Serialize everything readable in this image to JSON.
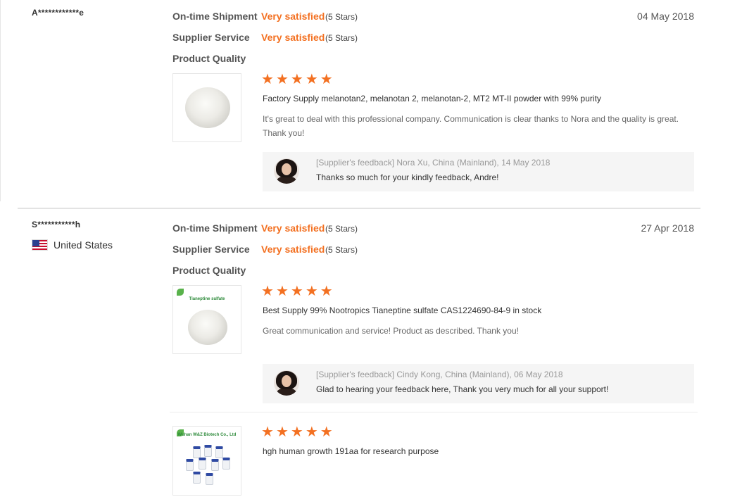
{
  "reviews": [
    {
      "buyer": "A************e",
      "country": "",
      "date": "04 May 2018",
      "ratings": [
        {
          "label": "On-time Shipment",
          "value": "Very satisfied",
          "stars": "(5 Stars)"
        },
        {
          "label": "Supplier Service",
          "value": "Very satisfied",
          "stars": "(5 Stars)"
        },
        {
          "label": "Product Quality",
          "value": "",
          "stars": ""
        }
      ],
      "products": [
        {
          "image_icon": "white-powder-image",
          "image_caption": "",
          "star_count": 5,
          "title": "Factory Supply melanotan2, melanotan 2, melanotan-2, MT2 MT-II powder with 99% purity",
          "comment_line1": "It's great to deal with this professional company. Communication is clear thanks to Nora and the quality is great.",
          "comment_line2": "Thank you!",
          "feedback": {
            "meta": "[Supplier's feedback] Nora Xu, China (Mainland), 14 May 2018",
            "text": "Thanks so much for your kindly feedback, Andre!"
          }
        }
      ]
    },
    {
      "buyer": "S***********h",
      "country": "United States",
      "country_flag_icon": "us-flag-icon",
      "date": "27 Apr 2018",
      "ratings": [
        {
          "label": "On-time Shipment",
          "value": "Very satisfied",
          "stars": "(5 Stars)"
        },
        {
          "label": "Supplier Service",
          "value": "Very satisfied",
          "stars": "(5 Stars)"
        },
        {
          "label": "Product Quality",
          "value": "",
          "stars": ""
        }
      ],
      "products": [
        {
          "image_icon": "tianeptine-powder-image",
          "image_caption": "Tianeptine sulfate",
          "star_count": 5,
          "title": "Best Supply 99% Nootropics Tianeptine sulfate CAS1224690-84-9 in stock",
          "comment_line1": "Great communication and service! Product as described. Thank you!",
          "feedback": {
            "meta": "[Supplier's feedback] Cindy Kong, China (Mainland), 06 May 2018",
            "text": "Glad to hearing your feedback here, Thank you very much for all your support!"
          }
        },
        {
          "image_icon": "vials-image",
          "image_caption": "Wuhan W&Z Biotech Co., Ltd",
          "star_count": 5,
          "title": "hgh human growth 191aa for research purpose"
        }
      ]
    }
  ],
  "colors": {
    "accent": "#f37021",
    "label": "#555555",
    "feedback_bg": "#f5f5f5"
  }
}
